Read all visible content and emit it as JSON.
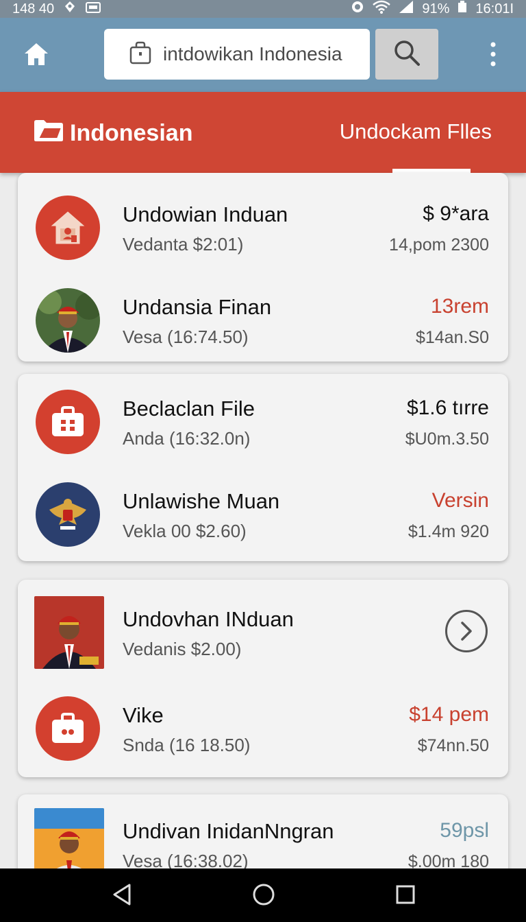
{
  "status_bar": {
    "time_left": "148 40",
    "battery": "91%",
    "time_right": "16:01I"
  },
  "app_bar": {
    "search_query": "intdowikan Indonesia",
    "icons": [
      "home-icon",
      "bag-icon",
      "search-icon",
      "more-vert-icon"
    ]
  },
  "tabs": {
    "left_label": "Indonesian",
    "right_label": "Undockam Flles"
  },
  "cards": [
    {
      "rows": [
        {
          "title": "Undowian Induan",
          "subtitle": "Vedanta $2:01)",
          "right_top": "$ 9*ara",
          "right_bottom": "14,pom 2300",
          "avatar": "house-icon"
        },
        {
          "title": "Undansia Finan",
          "subtitle": "Vesa (16:74.50)",
          "right_top": "13rem",
          "right_bottom": "$14an.S0",
          "avatar": "person-photo"
        }
      ]
    },
    {
      "rows": [
        {
          "title": "Beclaclan File",
          "subtitle": "Anda (16:32.0n)",
          "right_top": "$1.6 tırre",
          "right_bottom": "$U0m.3.50",
          "avatar": "briefcase-icon"
        },
        {
          "title": "Unlawishe Muan",
          "subtitle": "Vekla 00 $2.60)",
          "right_top": "Versin",
          "right_bottom": "$1.4m 920",
          "avatar": "emblem-icon"
        }
      ]
    },
    {
      "rows": [
        {
          "title": "Undovhan INduan",
          "subtitle": "Vedanis $2.00)",
          "right_top": "",
          "right_bottom": "",
          "avatar": "person-photo"
        },
        {
          "title": "Vike",
          "subtitle": "Snda (16 18.50)",
          "right_top": "$14 pem",
          "right_bottom": "$74nn.50",
          "avatar": "briefcase-icon"
        }
      ]
    },
    {
      "rows": [
        {
          "title": "Undivan InidanNngran",
          "subtitle": "Vesa (16:38.02)",
          "right_top": "59psl",
          "right_bottom": "$.00m 180",
          "avatar": "person-photo"
        }
      ]
    }
  ],
  "colors": {
    "brand_red": "#cf4634",
    "app_bar": "#6e97b4",
    "accent_teal": "#6e96a8"
  }
}
